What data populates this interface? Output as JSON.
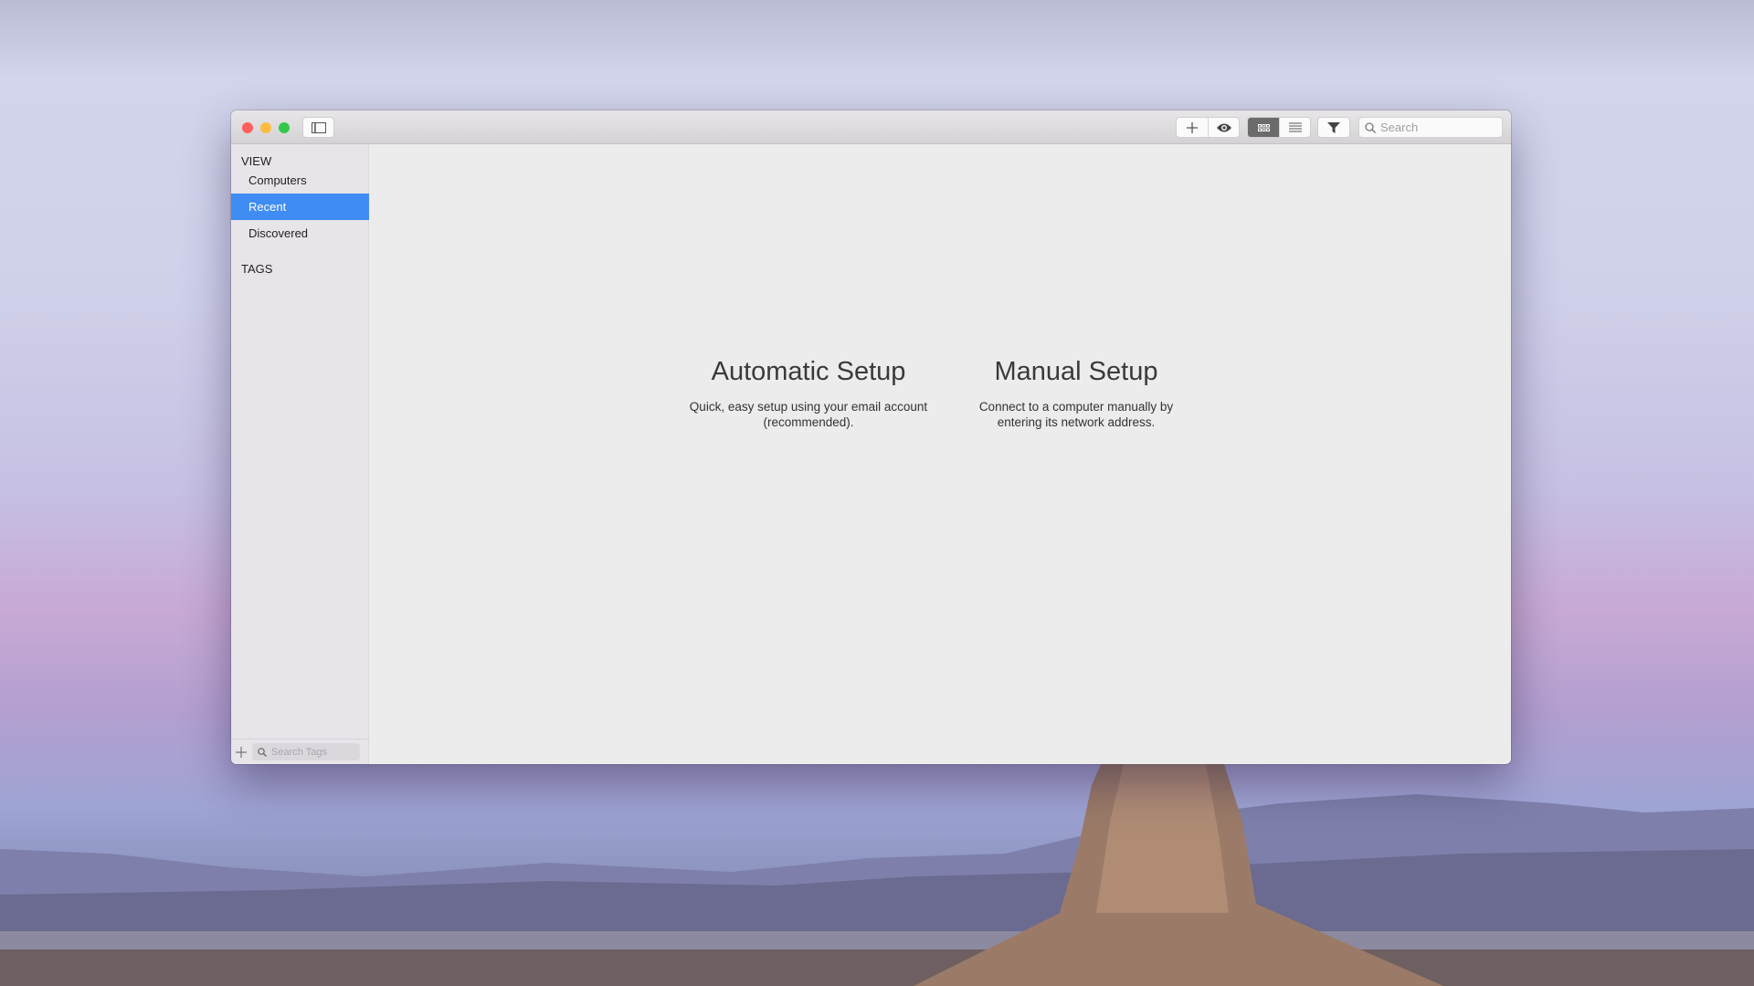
{
  "toolbar": {
    "search_placeholder": "Search"
  },
  "sidebar": {
    "view_header": "VIEW",
    "items": [
      {
        "label": "Computers"
      },
      {
        "label": "Recent",
        "selected": true
      },
      {
        "label": "Discovered"
      }
    ],
    "tags_header": "TAGS",
    "tag_search_placeholder": "Search Tags"
  },
  "main": {
    "options": [
      {
        "title": "Automatic Setup",
        "desc1": "Quick, easy setup using your email account",
        "desc2": "(recommended)."
      },
      {
        "title": "Manual Setup",
        "desc1": "Connect to a computer manually by",
        "desc2": "entering its network address."
      }
    ]
  },
  "colors": {
    "accent": "#3f8cf3",
    "close": "#fc605c",
    "minimize": "#fdbc40",
    "zoom": "#34c84a"
  }
}
